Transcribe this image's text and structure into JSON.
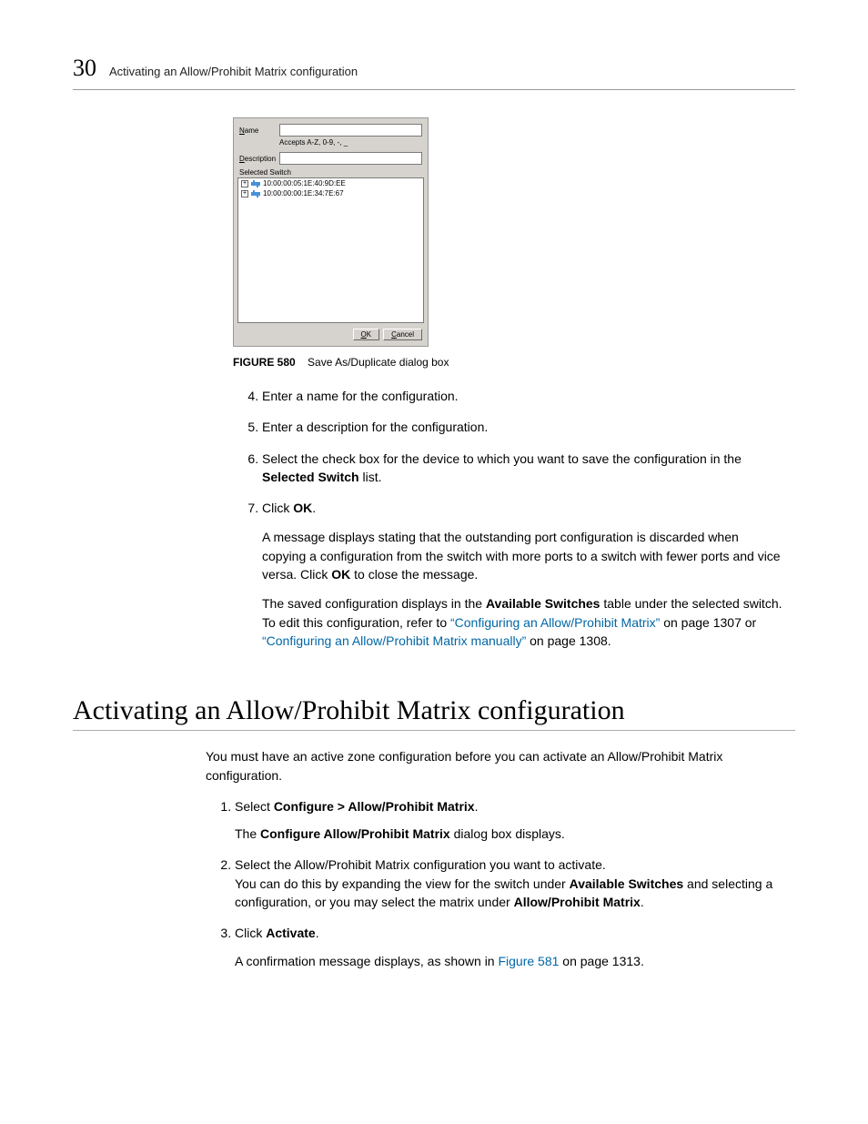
{
  "header": {
    "chapter_number": "30",
    "title": "Activating an Allow/Prohibit Matrix configuration"
  },
  "dialog": {
    "name_label": "Name",
    "name_value": "",
    "hint": "Accepts A-Z, 0-9, -, _",
    "description_label": "Description",
    "description_value": "",
    "selected_switch_label": "Selected Switch",
    "rows": [
      {
        "wwn": "10:00:00:05:1E:40:9D:EE"
      },
      {
        "wwn": "10:00:00:00:1E:34:7E:67"
      }
    ],
    "ok_label": "OK",
    "cancel_label": "Cancel"
  },
  "caption": {
    "prefix": "FIGURE 580",
    "text": "Save As/Duplicate dialog box"
  },
  "steps_a": {
    "s4": "Enter a name for the configuration.",
    "s5": "Enter a description for the configuration.",
    "s6_a": "Select the check box for the device to which you want to save the configuration in the ",
    "s6_b": "Selected Switch",
    "s6_c": " list.",
    "s7_a": "Click ",
    "s7_b": "OK",
    "s7_c": ".",
    "s7_p1_a": "A message displays stating that the outstanding port configuration is discarded when copying a configuration from the switch with more ports to a switch with fewer ports and vice versa. Click ",
    "s7_p1_b": "OK",
    "s7_p1_c": " to close the message.",
    "s7_p2_a": "The saved configuration displays in the ",
    "s7_p2_b": "Available Switches",
    "s7_p2_c": " table under the selected switch. To edit this configuration, refer to ",
    "s7_p2_link1": "“Configuring an Allow/Prohibit Matrix”",
    "s7_p2_d": " on page 1307 or ",
    "s7_p2_link2": "“Configuring an Allow/Prohibit Matrix manually”",
    "s7_p2_e": " on page 1308."
  },
  "section_heading": "Activating an Allow/Prohibit Matrix configuration",
  "intro": "You must have an active zone configuration before you can activate an Allow/Prohibit Matrix configuration.",
  "steps_b": {
    "s1_a": "Select ",
    "s1_b": "Configure > Allow/Prohibit Matrix",
    "s1_c": ".",
    "s1_p_a": "The ",
    "s1_p_b": "Configure Allow/Prohibit Matrix",
    "s1_p_c": " dialog box displays.",
    "s2_a": "Select the Allow/Prohibit Matrix configuration you want to activate.",
    "s2_b": "You can do this by expanding the view for the switch under ",
    "s2_c": "Available Switches",
    "s2_d": " and selecting a configuration, or you may select the matrix under ",
    "s2_e": "Allow/Prohibit Matrix",
    "s2_f": ".",
    "s3_a": "Click ",
    "s3_b": "Activate",
    "s3_c": ".",
    "s3_p_a": "A confirmation message displays, as shown in ",
    "s3_p_link": "Figure 581",
    "s3_p_b": " on page 1313."
  }
}
